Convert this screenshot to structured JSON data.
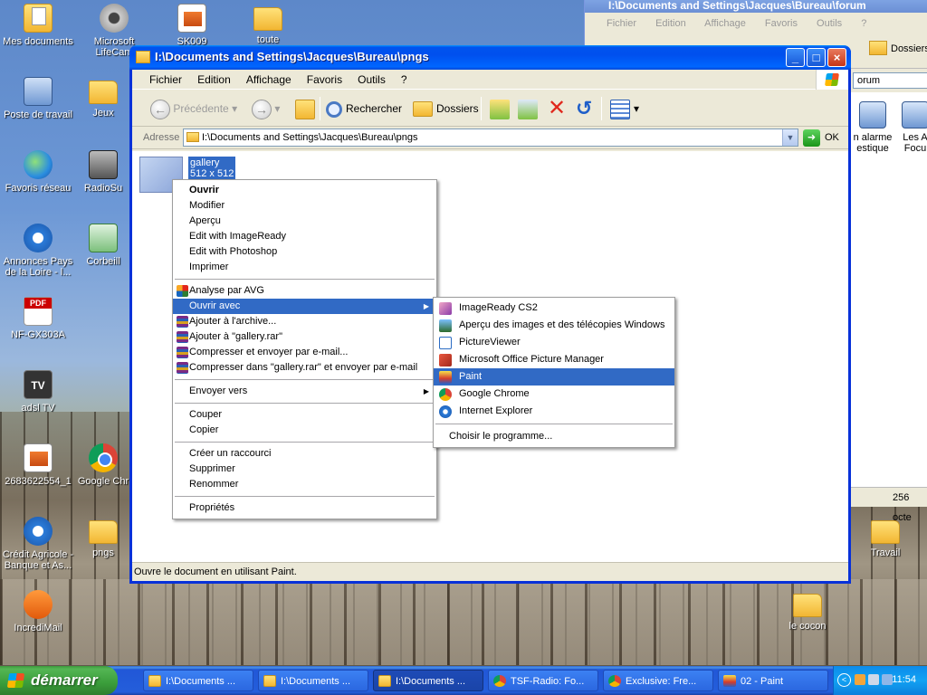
{
  "desktop": {
    "icons": [
      {
        "label": "Mes documents",
        "icon": "documents-folder-icon"
      },
      {
        "label": "Microsoft LifeCam",
        "icon": "webcam-icon"
      },
      {
        "label": "SK009",
        "icon": "document-icon"
      },
      {
        "label": "toute",
        "icon": "folder-icon"
      },
      {
        "label": "Poste de travail",
        "icon": "computer-icon"
      },
      {
        "label": "Jeux",
        "icon": "folder-icon"
      },
      {
        "label": "Favoris réseau",
        "icon": "network-icon"
      },
      {
        "label": "RadioSu",
        "icon": "radio-icon"
      },
      {
        "label": "Annonces Pays de la Loire - l...",
        "icon": "ie-icon"
      },
      {
        "label": "Corbeill",
        "icon": "recycle-bin-icon"
      },
      {
        "label": "NF-GX303A",
        "icon": "pdf-icon"
      },
      {
        "label": "adsl TV",
        "icon": "tv-icon"
      },
      {
        "label": "2683622554_1",
        "icon": "document-icon"
      },
      {
        "label": "Google Chr",
        "icon": "chrome-icon"
      },
      {
        "label": "Crédit Agricole - Banque et As...",
        "icon": "ie-icon"
      },
      {
        "label": "pngs",
        "icon": "folder-icon"
      },
      {
        "label": "IncrediMail",
        "icon": "mail-icon"
      },
      {
        "label": "Travail",
        "icon": "folder-icon"
      },
      {
        "label": "le cocon",
        "icon": "folder-icon"
      }
    ]
  },
  "back_window": {
    "title": "I:\\Documents and Settings\\Jacques\\Bureau\\forum",
    "menu": [
      "Fichier",
      "Edition",
      "Affichage",
      "Favoris",
      "Outils",
      "?"
    ],
    "folders_label": "Dossiers",
    "address_fragment": "orum",
    "icon1_label": "n alarme estique",
    "icon2_label": "Les A Focu",
    "status_size": "256 octe"
  },
  "window": {
    "title": "I:\\Documents and Settings\\Jacques\\Bureau\\pngs",
    "menu": [
      "Fichier",
      "Edition",
      "Affichage",
      "Favoris",
      "Outils",
      "?"
    ],
    "toolbar": {
      "back": "Précédente",
      "search": "Rechercher",
      "folders": "Dossiers"
    },
    "address_label": "Adresse",
    "address_value": "I:\\Documents and Settings\\Jacques\\Bureau\\pngs",
    "go_label": "OK",
    "file_name": "gallery",
    "file_size": "512 x 512",
    "status": "Ouvre le document en utilisant Paint."
  },
  "context_menu": {
    "group1": [
      "Ouvrir",
      "Modifier",
      "Aperçu",
      "Edit with ImageReady",
      "Edit with Photoshop",
      "Imprimer"
    ],
    "group2": [
      "Analyse par AVG",
      "Ouvrir avec",
      "Ajouter à l'archive...",
      "Ajouter à \"gallery.rar\"",
      "Compresser et envoyer par e-mail...",
      "Compresser dans \"gallery.rar\" et envoyer par e-mail"
    ],
    "group3": [
      "Envoyer vers"
    ],
    "group4": [
      "Couper",
      "Copier"
    ],
    "group5": [
      "Créer un raccourci",
      "Supprimer",
      "Renommer"
    ],
    "group6": [
      "Propriétés"
    ]
  },
  "submenu": {
    "apps": [
      "ImageReady CS2",
      "Aperçu des images et des télécopies Windows",
      "PictureViewer",
      "Microsoft Office Picture Manager",
      "Paint",
      "Google Chrome",
      "Internet Explorer"
    ],
    "choose": "Choisir le programme...",
    "highlighted": "Paint"
  },
  "taskbar": {
    "start": "démarrer",
    "buttons": [
      "I:\\Documents ...",
      "I:\\Documents ...",
      "I:\\Documents ...",
      "TSF-Radio: Fo...",
      "Exclusive: Fre...",
      "02 - Paint"
    ],
    "clock": "11:54"
  }
}
